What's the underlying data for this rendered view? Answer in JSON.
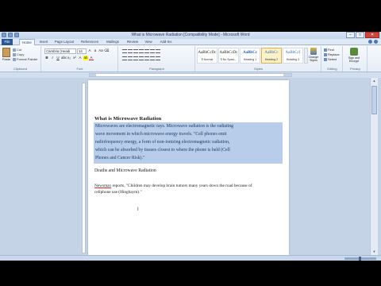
{
  "window": {
    "title": "What is Microwave Radiation [Compatibility Mode] - Microsoft Word",
    "controls": {
      "minimize": "–",
      "maximize": "□",
      "close": "✕"
    }
  },
  "tabs": [
    {
      "label": "File"
    },
    {
      "label": "Home"
    },
    {
      "label": "Insert"
    },
    {
      "label": "Page Layout"
    },
    {
      "label": "References"
    },
    {
      "label": "Mailings"
    },
    {
      "label": "Review"
    },
    {
      "label": "View"
    },
    {
      "label": "Add-Ins"
    }
  ],
  "ribbon": {
    "clipboard": {
      "paste": "Paste",
      "cut": "Cut",
      "copy": "Copy",
      "format_painter": "Format Painter",
      "label": "Clipboard"
    },
    "font": {
      "family": "Cambria (Headi",
      "size": "14",
      "label": "Font"
    },
    "paragraph": {
      "label": "Paragraph"
    },
    "styles": {
      "items": [
        {
          "sample": "AaBbCcDc",
          "name": "¶ Normal"
        },
        {
          "sample": "AaBbCcDc",
          "name": "¶ No Spaci..."
        },
        {
          "sample": "AaBbCc",
          "name": "Heading 1"
        },
        {
          "sample": "AaBbCc",
          "name": "Heading 2"
        },
        {
          "sample": "AaBbCcI",
          "name": "Heading 3"
        }
      ],
      "change_styles": "Change Styles",
      "label": "Styles"
    },
    "editing": {
      "find": "Find",
      "replace": "Replace",
      "select": "Select",
      "label": "Editing"
    },
    "signature": {
      "label": "Sign and Encrypt",
      "group": "Privacy"
    }
  },
  "document": {
    "heading": "What is Microwave Radiation",
    "paragraph_lines": [
      "Microwaves are electromagnetic rays. Microwave radiation is the radiating",
      "wave movement in which microwave energy travels. \"Cell phones emit",
      "radiofrequency energy, a form of non-ionizing electromagnetic radiation,",
      "which can be absorbed by tissues closest to where the phone is held (Cell",
      "Phones and Cancer Risk).\""
    ],
    "subheading": "Deaths and Microwave Radiation",
    "quote_lines": [
      {
        "underlined": "Newsmax",
        "rest": " reports, \"Children may develop brain tumors many years down the road because of"
      },
      {
        "underlined": "",
        "rest": "cellphone use (Hinghaym).\""
      }
    ],
    "cursor": "I"
  },
  "status": {
    "page": "",
    "words": ""
  }
}
